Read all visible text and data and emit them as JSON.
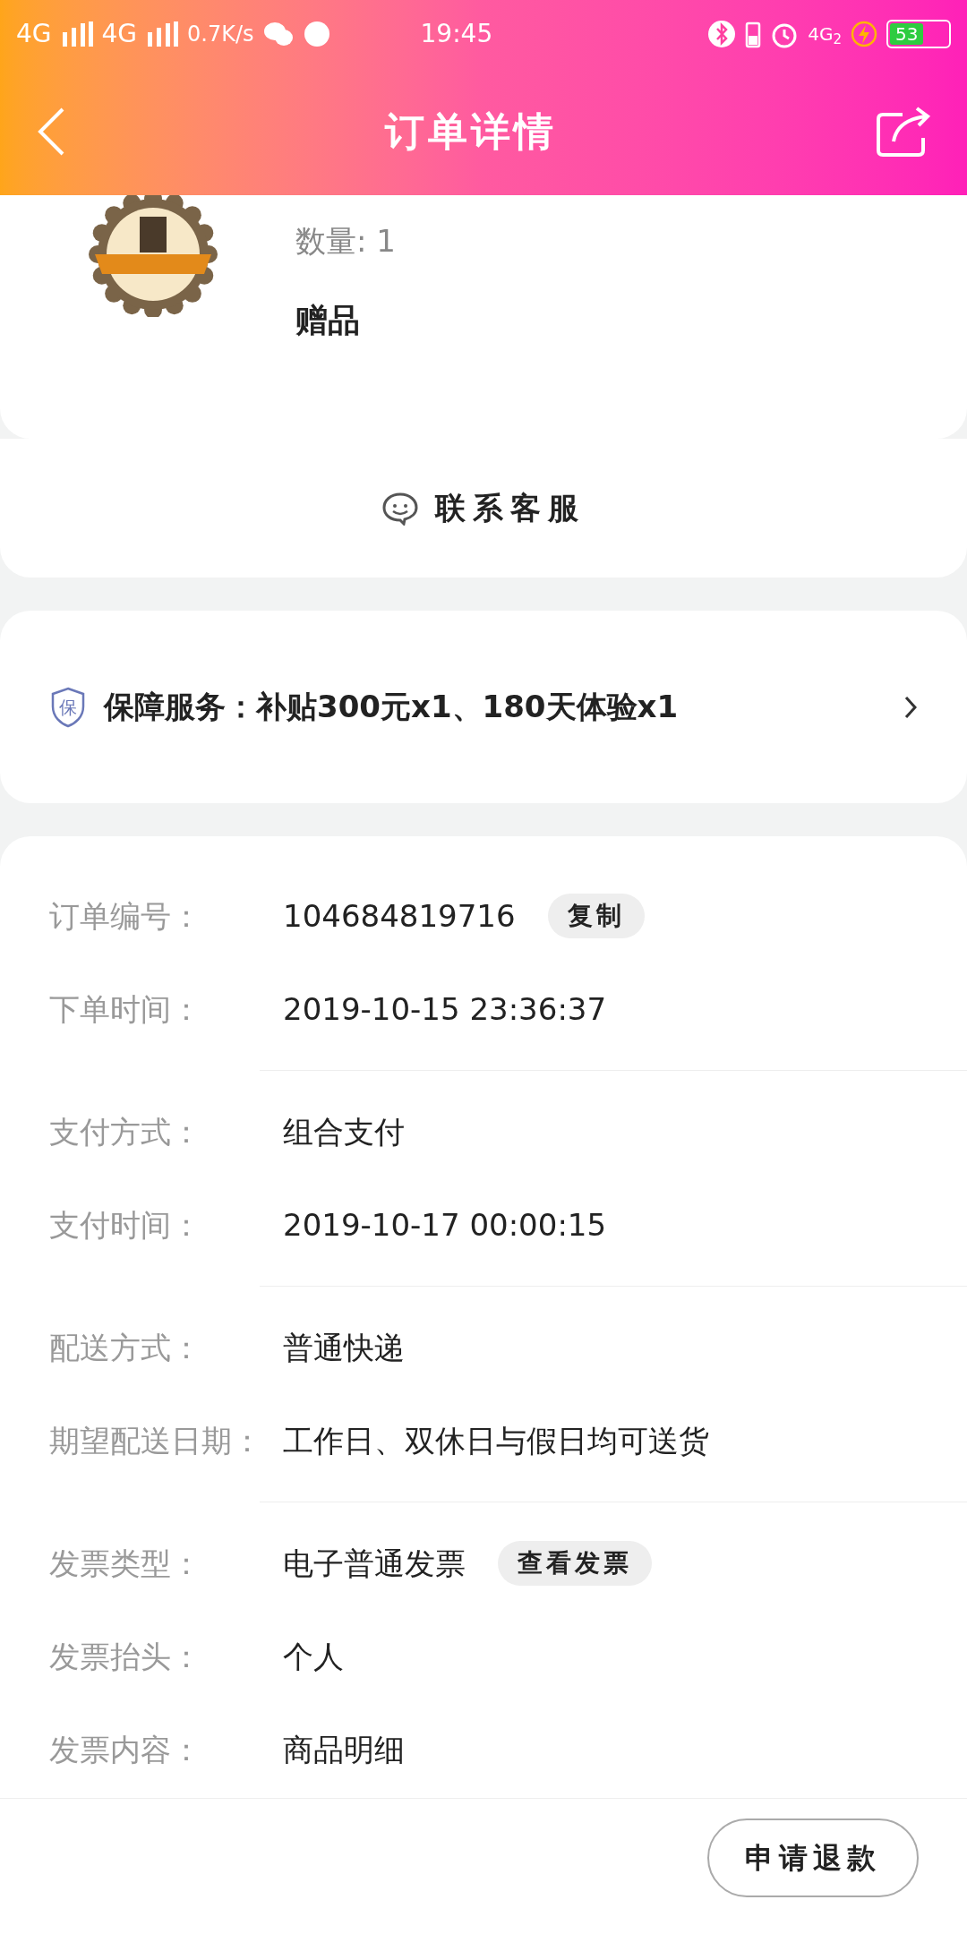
{
  "status_bar": {
    "network_1": "4G",
    "network_2": "4G",
    "speed": "0.7K/s",
    "time": "19:45",
    "network_3": "4G$_{2}$",
    "battery": "53"
  },
  "header": {
    "title": "订单详情"
  },
  "gift_item": {
    "quantity": "数量: 1",
    "gift_label": "赠品"
  },
  "contact": {
    "label": "联系客服"
  },
  "protection": {
    "badge": "保",
    "label": "保障服务：补贴300元x1、180天体验x1"
  },
  "order_info": {
    "groups": [
      [
        {
          "label": "订单编号：",
          "value": "104684819716",
          "action": "复制"
        },
        {
          "label": "下单时间：",
          "value": "2019-10-15 23:36:37"
        }
      ],
      [
        {
          "label": "支付方式：",
          "value": "组合支付"
        },
        {
          "label": "支付时间：",
          "value": "2019-10-17 00:00:15"
        }
      ],
      [
        {
          "label": "配送方式：",
          "value": "普通快递"
        },
        {
          "label": "期望配送日期：",
          "value": "工作日、双休日与假日均可送货"
        }
      ],
      [
        {
          "label": "发票类型：",
          "value": "电子普通发票",
          "action": "查看发票"
        },
        {
          "label": "发票抬头：",
          "value": "个人"
        },
        {
          "label": "发票内容：",
          "value": "商品明细"
        }
      ]
    ]
  },
  "footer": {
    "button": "申请退款"
  }
}
